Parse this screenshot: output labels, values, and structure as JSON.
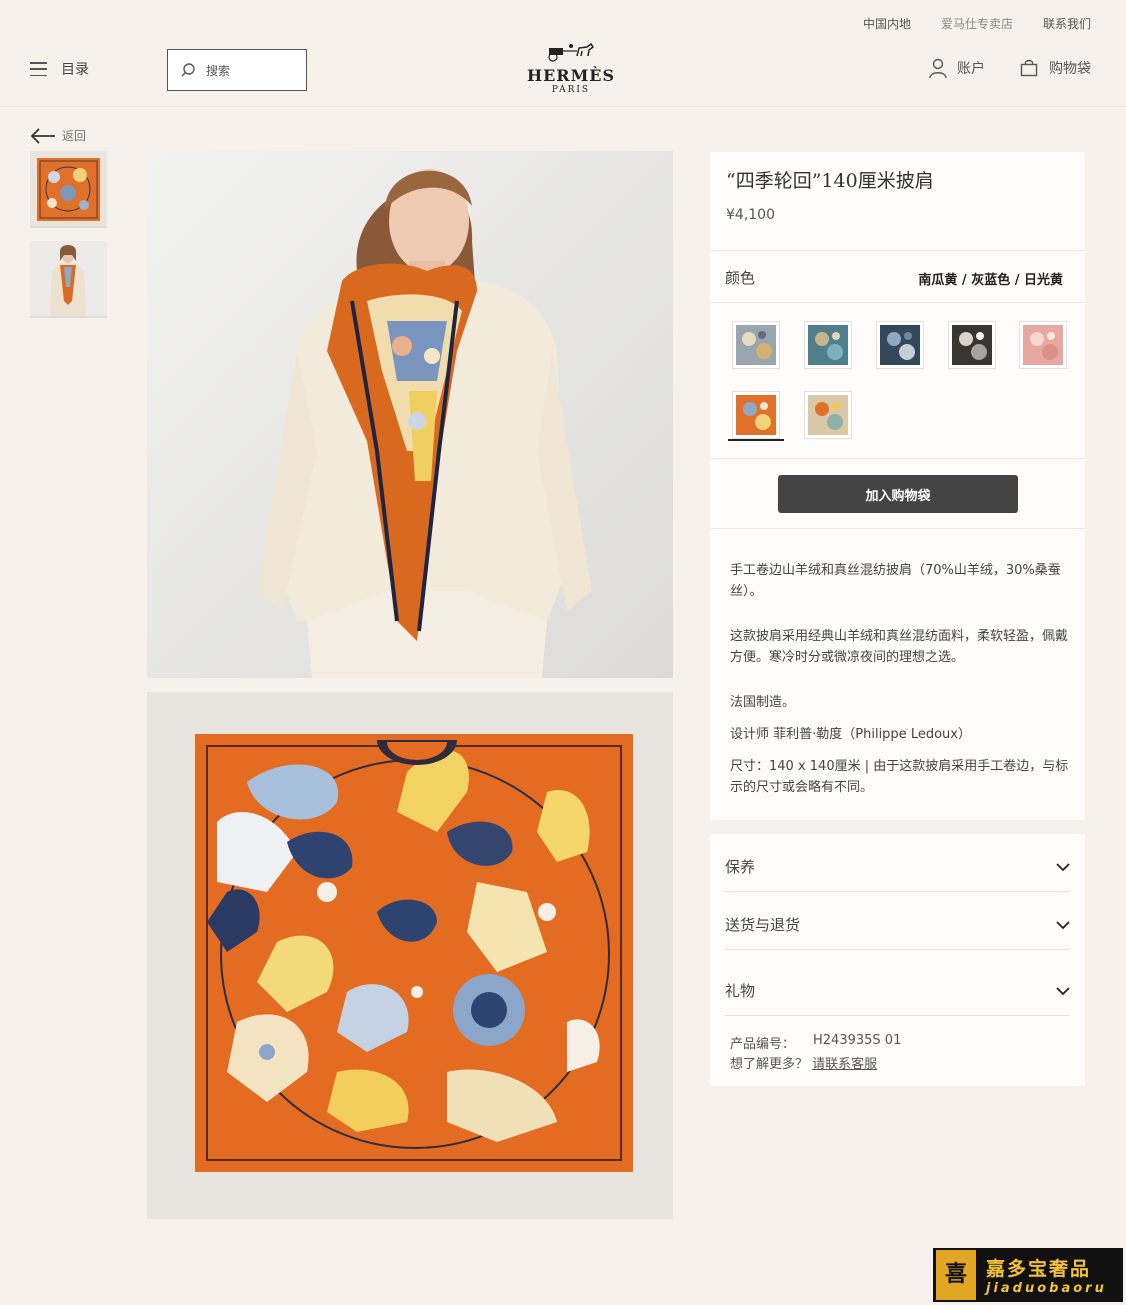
{
  "top_links": [
    "中国内地",
    "爱马仕专卖店",
    "联系我们"
  ],
  "header": {
    "menu_label": "目录",
    "search_placeholder": "搜索",
    "brand": "HERMÈS",
    "brand_city": "PARIS",
    "account_label": "账户",
    "bag_label": "购物袋"
  },
  "back_label": "返回",
  "product": {
    "title": "“四季轮回”140厘米披肩",
    "price": "¥4,100",
    "color_label": "颜色",
    "color_value": "南瓜黄 / 灰蓝色 / 日光黄",
    "swatches": [
      {
        "name": "grey-multi",
        "color": "#9aa6ad",
        "selected": false
      },
      {
        "name": "teal",
        "color": "#4f7e8c",
        "selected": false
      },
      {
        "name": "slate",
        "color": "#33485a",
        "selected": false
      },
      {
        "name": "black",
        "color": "#3a3432",
        "selected": false
      },
      {
        "name": "pink",
        "color": "#e6a8a0",
        "selected": false
      },
      {
        "name": "orange",
        "color": "#e0702a",
        "selected": true
      },
      {
        "name": "beige-orange",
        "color": "#d9c9a6",
        "selected": false
      }
    ],
    "add_to_bag": "加入购物袋",
    "desc_1": "手工卷边山羊绒和真丝混纺披肩（70%山羊绒，30%桑蚕丝）。",
    "desc_2": "这款披肩采用经典山羊绒和真丝混纺面料，柔软轻盈，佩戴方便。寒冷时分或微凉夜间的理想之选。",
    "desc_3": "法国制造。",
    "desc_4": "设计师 菲利普·勒度（Philippe Ledoux）",
    "desc_5": "尺寸：140 x 140厘米 | 由于这款披肩采用手工卷边，与标示的尺寸或会略有不同。"
  },
  "accordion": [
    "保养",
    "送货与退货",
    "礼物"
  ],
  "product_code_label": "产品编号：",
  "product_code": "H243935S 01",
  "more_label": "想了解更多？",
  "more_link": "请联系客服",
  "watermark": {
    "seal": "喜",
    "cn": "嘉多宝奢品",
    "en": "jiaduobaoru"
  },
  "colors": {
    "background": "#f6f1eb",
    "panel": "#fdfcfa",
    "button": "#444444",
    "scarf_orange": "#e0702a"
  }
}
